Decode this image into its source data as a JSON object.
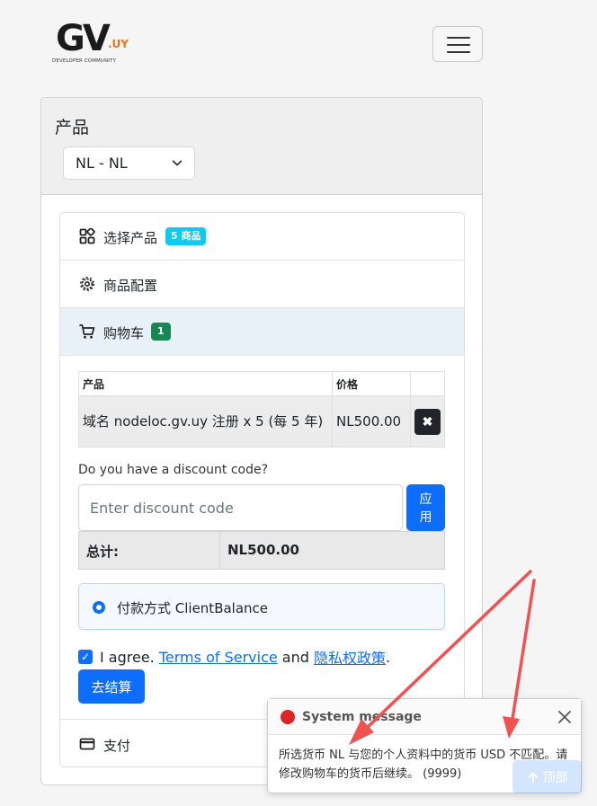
{
  "brand": {
    "logo_main": "GV",
    "logo_suffix": ".UY",
    "logo_tagline": "DEVELOPER COMMUNITY"
  },
  "header": {
    "title": "产品",
    "currency_selected": "NL - NL"
  },
  "steps": {
    "select_product": {
      "label": "选择产品",
      "badge": "5 商品"
    },
    "config": {
      "label": "商品配置"
    },
    "cart": {
      "label": "购物车",
      "badge": "1"
    },
    "payment": {
      "label": "支付"
    }
  },
  "cart_table": {
    "headers": [
      "产品",
      "价格",
      ""
    ],
    "rows": [
      {
        "product": "域名 nodeloc.gv.uy 注册 x 5 (每 5 年)",
        "price": "NL500.00",
        "remove": "✖"
      }
    ]
  },
  "discount": {
    "label": "Do you have a discount code?",
    "placeholder": "Enter discount code",
    "value": "",
    "apply_label": "应用"
  },
  "total": {
    "label": "总计:",
    "value": "NL500.00"
  },
  "payment_method": {
    "label": "付款方式 ClientBalance"
  },
  "agreement": {
    "prefix": "I agree.",
    "tos": "Terms of Service",
    "and": "and",
    "privacy": "隐私权政策",
    "suffix": "."
  },
  "checkout_label": "去结算",
  "toast": {
    "title": "System message",
    "message": "所选货币 NL 与您的个人资料中的货币 USD 不匹配。请修改购物车的货币后继续。 (9999)",
    "status_color": "#dc2626"
  },
  "back_to_top": "顶部",
  "colors": {
    "primary": "#0d6efd",
    "info_badge": "#0dcaf0",
    "success_badge": "#198754",
    "annotation_arrow": "#f05252"
  }
}
